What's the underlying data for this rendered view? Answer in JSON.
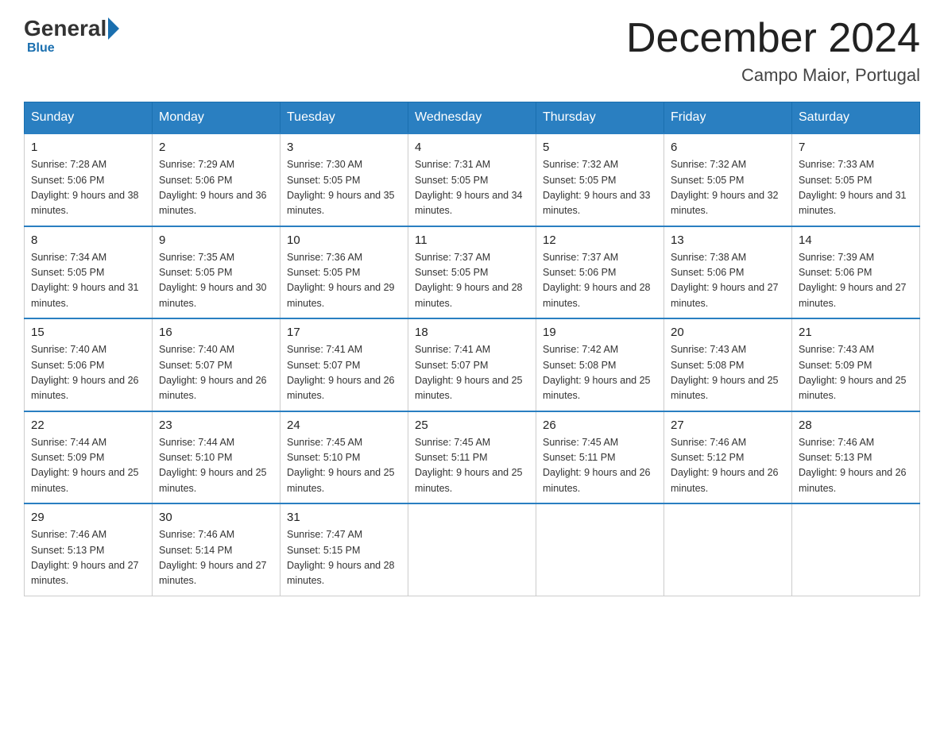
{
  "header": {
    "logo": {
      "part1": "General",
      "part2": "Blue"
    },
    "title": "December 2024",
    "location": "Campo Maior, Portugal"
  },
  "weekdays": [
    "Sunday",
    "Monday",
    "Tuesday",
    "Wednesday",
    "Thursday",
    "Friday",
    "Saturday"
  ],
  "weeks": [
    [
      {
        "day": "1",
        "sunrise": "7:28 AM",
        "sunset": "5:06 PM",
        "daylight": "9 hours and 38 minutes."
      },
      {
        "day": "2",
        "sunrise": "7:29 AM",
        "sunset": "5:06 PM",
        "daylight": "9 hours and 36 minutes."
      },
      {
        "day": "3",
        "sunrise": "7:30 AM",
        "sunset": "5:05 PM",
        "daylight": "9 hours and 35 minutes."
      },
      {
        "day": "4",
        "sunrise": "7:31 AM",
        "sunset": "5:05 PM",
        "daylight": "9 hours and 34 minutes."
      },
      {
        "day": "5",
        "sunrise": "7:32 AM",
        "sunset": "5:05 PM",
        "daylight": "9 hours and 33 minutes."
      },
      {
        "day": "6",
        "sunrise": "7:32 AM",
        "sunset": "5:05 PM",
        "daylight": "9 hours and 32 minutes."
      },
      {
        "day": "7",
        "sunrise": "7:33 AM",
        "sunset": "5:05 PM",
        "daylight": "9 hours and 31 minutes."
      }
    ],
    [
      {
        "day": "8",
        "sunrise": "7:34 AM",
        "sunset": "5:05 PM",
        "daylight": "9 hours and 31 minutes."
      },
      {
        "day": "9",
        "sunrise": "7:35 AM",
        "sunset": "5:05 PM",
        "daylight": "9 hours and 30 minutes."
      },
      {
        "day": "10",
        "sunrise": "7:36 AM",
        "sunset": "5:05 PM",
        "daylight": "9 hours and 29 minutes."
      },
      {
        "day": "11",
        "sunrise": "7:37 AM",
        "sunset": "5:05 PM",
        "daylight": "9 hours and 28 minutes."
      },
      {
        "day": "12",
        "sunrise": "7:37 AM",
        "sunset": "5:06 PM",
        "daylight": "9 hours and 28 minutes."
      },
      {
        "day": "13",
        "sunrise": "7:38 AM",
        "sunset": "5:06 PM",
        "daylight": "9 hours and 27 minutes."
      },
      {
        "day": "14",
        "sunrise": "7:39 AM",
        "sunset": "5:06 PM",
        "daylight": "9 hours and 27 minutes."
      }
    ],
    [
      {
        "day": "15",
        "sunrise": "7:40 AM",
        "sunset": "5:06 PM",
        "daylight": "9 hours and 26 minutes."
      },
      {
        "day": "16",
        "sunrise": "7:40 AM",
        "sunset": "5:07 PM",
        "daylight": "9 hours and 26 minutes."
      },
      {
        "day": "17",
        "sunrise": "7:41 AM",
        "sunset": "5:07 PM",
        "daylight": "9 hours and 26 minutes."
      },
      {
        "day": "18",
        "sunrise": "7:41 AM",
        "sunset": "5:07 PM",
        "daylight": "9 hours and 25 minutes."
      },
      {
        "day": "19",
        "sunrise": "7:42 AM",
        "sunset": "5:08 PM",
        "daylight": "9 hours and 25 minutes."
      },
      {
        "day": "20",
        "sunrise": "7:43 AM",
        "sunset": "5:08 PM",
        "daylight": "9 hours and 25 minutes."
      },
      {
        "day": "21",
        "sunrise": "7:43 AM",
        "sunset": "5:09 PM",
        "daylight": "9 hours and 25 minutes."
      }
    ],
    [
      {
        "day": "22",
        "sunrise": "7:44 AM",
        "sunset": "5:09 PM",
        "daylight": "9 hours and 25 minutes."
      },
      {
        "day": "23",
        "sunrise": "7:44 AM",
        "sunset": "5:10 PM",
        "daylight": "9 hours and 25 minutes."
      },
      {
        "day": "24",
        "sunrise": "7:45 AM",
        "sunset": "5:10 PM",
        "daylight": "9 hours and 25 minutes."
      },
      {
        "day": "25",
        "sunrise": "7:45 AM",
        "sunset": "5:11 PM",
        "daylight": "9 hours and 25 minutes."
      },
      {
        "day": "26",
        "sunrise": "7:45 AM",
        "sunset": "5:11 PM",
        "daylight": "9 hours and 26 minutes."
      },
      {
        "day": "27",
        "sunrise": "7:46 AM",
        "sunset": "5:12 PM",
        "daylight": "9 hours and 26 minutes."
      },
      {
        "day": "28",
        "sunrise": "7:46 AM",
        "sunset": "5:13 PM",
        "daylight": "9 hours and 26 minutes."
      }
    ],
    [
      {
        "day": "29",
        "sunrise": "7:46 AM",
        "sunset": "5:13 PM",
        "daylight": "9 hours and 27 minutes."
      },
      {
        "day": "30",
        "sunrise": "7:46 AM",
        "sunset": "5:14 PM",
        "daylight": "9 hours and 27 minutes."
      },
      {
        "day": "31",
        "sunrise": "7:47 AM",
        "sunset": "5:15 PM",
        "daylight": "9 hours and 28 minutes."
      },
      null,
      null,
      null,
      null
    ]
  ]
}
